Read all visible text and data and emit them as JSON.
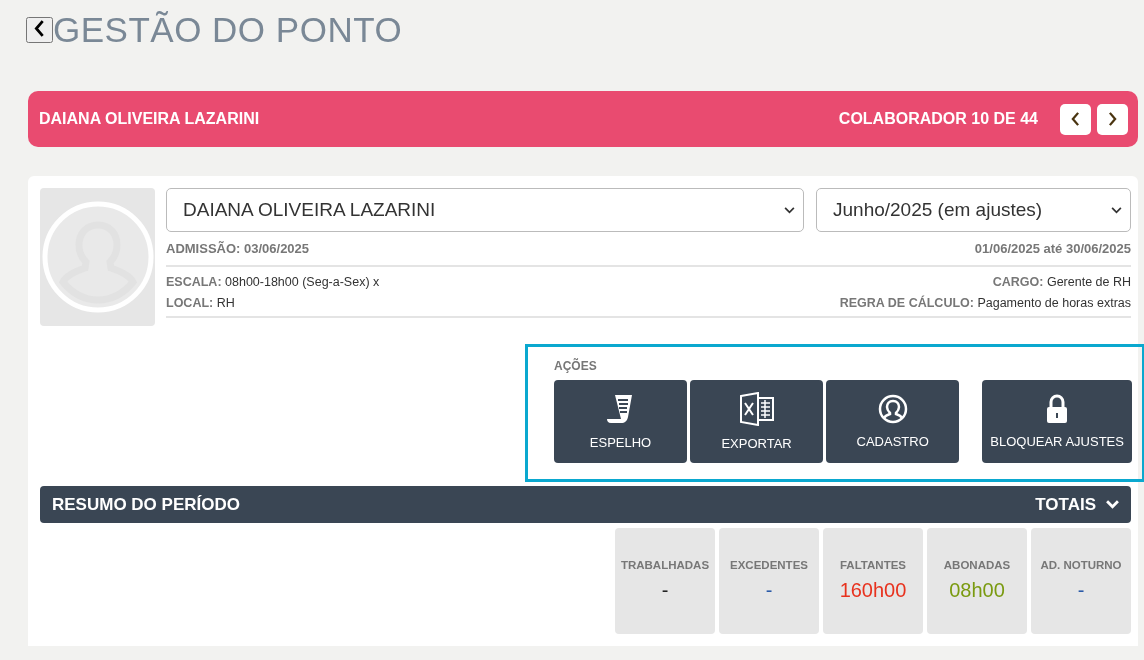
{
  "page": {
    "title": "GESTÃO DO PONTO"
  },
  "employee_bar": {
    "name": "DAIANA OLIVEIRA LAZARINI",
    "counter": "COLABORADOR 10 DE 44"
  },
  "profile": {
    "employee_select": "DAIANA OLIVEIRA LAZARINI",
    "period_select": "Junho/2025 (em ajustes)",
    "admission": "ADMISSÃO: 03/06/2025",
    "period_range": "01/06/2025 até 30/06/2025",
    "details_left": [
      "**ESCALA:** 08h00-18h00 (Seg-a-Sex) x",
      "**LOCAL:** RH"
    ],
    "details_right": [
      "**CARGO:** Gerente de RH",
      "**REGRA DE CÁLCULO:** Pagamento de horas extras"
    ]
  },
  "actions": {
    "title": "AÇÕES",
    "buttons": [
      {
        "kind": "mirror",
        "label": "ESPELHO"
      },
      {
        "kind": "export",
        "label": "EXPORTAR"
      },
      {
        "kind": "profile",
        "label": "CADASTRO"
      },
      {
        "kind": "lock",
        "label": "BLOQUEAR AJUSTES"
      }
    ]
  },
  "summary": {
    "title": "RESUMO DO PERÍODO",
    "toggle": "TOTAIS",
    "expanded": true,
    "totals": [
      {
        "label": "TRABALHADAS",
        "value": "-",
        "color": "#222222"
      },
      {
        "label": "EXCEDENTES",
        "value": "-",
        "color": "#2a5aa8"
      },
      {
        "label": "FALTANTES",
        "value": "160h00",
        "color": "#e8321e"
      },
      {
        "label": "ABONADAS",
        "value": "08h00",
        "color": "#7a9a10"
      },
      {
        "label": "AD. NOTURNO",
        "value": "-",
        "color": "#2a5aa8"
      }
    ]
  }
}
